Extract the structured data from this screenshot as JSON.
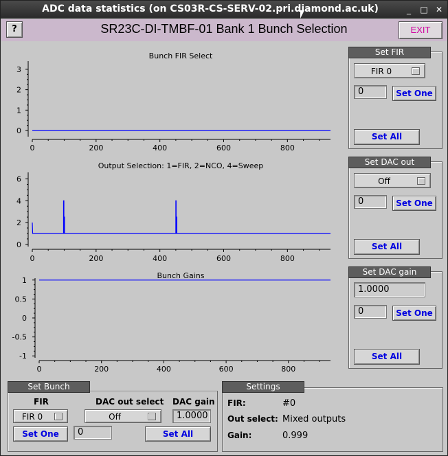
{
  "window": {
    "title": "ADC data statistics (on CS03R-CS-SERV-02.pri.diamond.ac.uk)",
    "minimize_glyph": "_",
    "maximize_glyph": "□",
    "close_glyph": "✕"
  },
  "header": {
    "help_label": "?",
    "title": "SR23C-DI-TMBF-01 Bank 1 Bunch Selection",
    "exit_label": "EXIT"
  },
  "chart_data": [
    {
      "type": "line",
      "title": "Bunch FIR Select",
      "xticks": [
        "0",
        "200",
        "400",
        "600",
        "800"
      ],
      "yticks": [
        "0",
        "1",
        "2",
        "3"
      ],
      "xlim": [
        0,
        935
      ],
      "ylim": [
        -0.3,
        3.4
      ],
      "series": [
        {
          "x": [
            0,
            935
          ],
          "y": [
            0,
            0
          ]
        }
      ],
      "color": "#0000ff"
    },
    {
      "type": "line",
      "title": "Output Selection: 1=FIR, 2=NCO, 4=Sweep",
      "xticks": [
        "0",
        "200",
        "400",
        "600",
        "800"
      ],
      "yticks": [
        "0",
        "2",
        "4",
        "6"
      ],
      "xlim": [
        0,
        935
      ],
      "ylim": [
        -0.2,
        6.6
      ],
      "series": [
        {
          "x": [
            0,
            0,
            1,
            1,
            98,
            98,
            99,
            99,
            100,
            100,
            101,
            101,
            450,
            450,
            451,
            451,
            452,
            452,
            453,
            453,
            935
          ],
          "y": [
            2,
            2,
            1,
            1,
            1,
            4,
            4,
            1,
            1,
            2.5,
            2.5,
            1,
            1,
            4,
            4,
            1,
            1,
            2.5,
            2.5,
            1,
            1
          ]
        }
      ],
      "color": "#0000ff"
    },
    {
      "type": "line",
      "title": "Bunch Gains",
      "xticks": [
        "0",
        "200",
        "400",
        "600",
        "800"
      ],
      "yticks": [
        "1",
        "0.5",
        "0",
        "-0.5",
        "-1"
      ],
      "xlim": [
        0,
        935
      ],
      "ylim": [
        -1.05,
        1.05
      ],
      "series": [
        {
          "x": [
            0,
            935
          ],
          "y": [
            1,
            1
          ]
        }
      ],
      "color": "#0000ff"
    }
  ],
  "set_fir": {
    "title": "Set FIR",
    "menu_value": "FIR 0",
    "entry_value": "0",
    "set_one_label": "Set One",
    "set_all_label": "Set All"
  },
  "set_dac_out": {
    "title": "Set DAC out",
    "menu_value": "Off",
    "entry_value": "0",
    "set_one_label": "Set One",
    "set_all_label": "Set All"
  },
  "set_dac_gain": {
    "title": "Set DAC gain",
    "gain_value": "1.0000",
    "entry_value": "0",
    "set_one_label": "Set One",
    "set_all_label": "Set All"
  },
  "set_bunch": {
    "title": "Set Bunch",
    "fir_label": "FIR",
    "dac_out_select_label": "DAC out select",
    "dac_gain_label": "DAC gain",
    "fir_value": "FIR 0",
    "dac_out_value": "Off",
    "dac_gain_value": "1.0000",
    "entry_value": "0",
    "set_one_label": "Set One",
    "set_all_label": "Set All"
  },
  "settings": {
    "title": "Settings",
    "fir_label": "FIR:",
    "fir_value": "#0",
    "out_select_label": "Out select:",
    "out_select_value": "Mixed outputs",
    "gain_label": "Gain:",
    "gain_value": "0.999"
  }
}
